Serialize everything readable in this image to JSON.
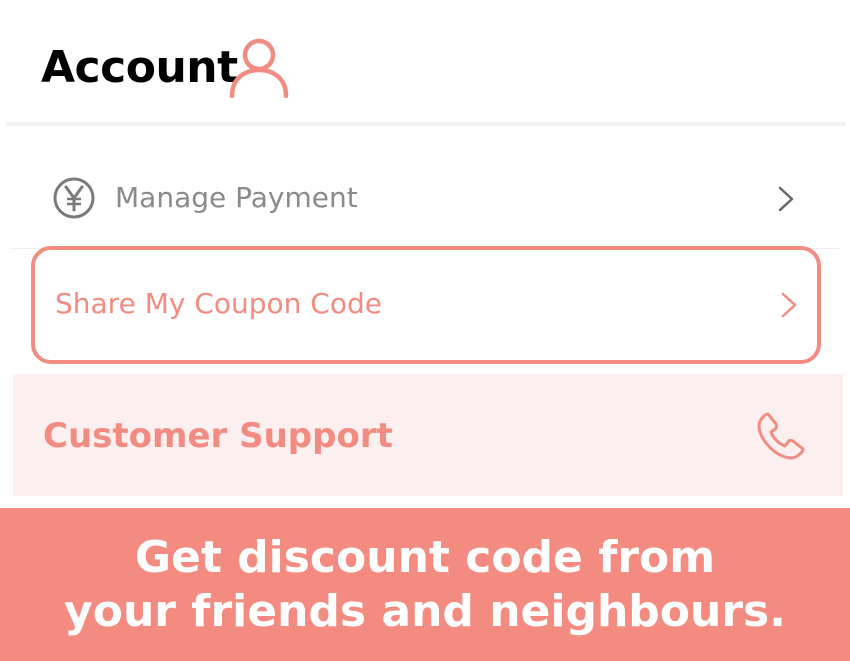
{
  "header": {
    "title": "Account",
    "icon": "user-icon"
  },
  "menu": {
    "payment": {
      "icon": "yen-icon",
      "label": "Manage Payment",
      "chevron": "chevron-right-icon"
    },
    "coupon": {
      "label": "Share My Coupon Code",
      "chevron": "chevron-right-icon"
    },
    "support": {
      "label": "Customer Support",
      "icon": "phone-icon"
    }
  },
  "banner": {
    "line1": "Get discount code from",
    "line2": "your friends and neighbours."
  },
  "colors": {
    "accent": "#f28b81",
    "banner_bg": "#f38b80",
    "support_bg": "#fcefef",
    "muted_text": "#8a8a8a"
  }
}
